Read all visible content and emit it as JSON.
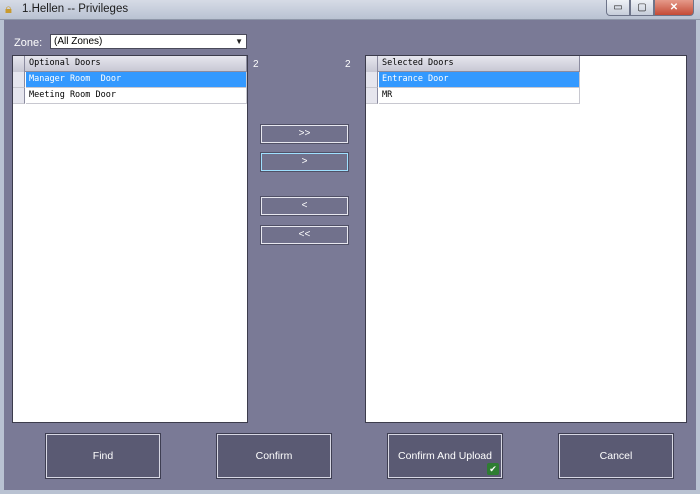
{
  "window": {
    "title": "1.Hellen -- Privileges",
    "minimize": "▭",
    "maximize": "▢",
    "close": "✕"
  },
  "zone": {
    "label": "Zone:",
    "selected": "(All Zones)"
  },
  "optional": {
    "count": "2",
    "header": "Optional Doors",
    "rows": [
      "Manager Room  Door",
      "Meeting Room Door"
    ]
  },
  "selected": {
    "count": "2",
    "header": "Selected Doors",
    "rows": [
      "Entrance Door",
      "MR"
    ]
  },
  "move_buttons": {
    "add_all": ">>",
    "add_one": ">",
    "remove_one": "<",
    "remove_all": "<<"
  },
  "actions": {
    "find": "Find",
    "confirm": "Confirm",
    "confirm_upload": "Confirm And Upload",
    "cancel": "Cancel"
  },
  "icons": {
    "app": "lock-icon",
    "upload_badge": "upload-check-icon"
  },
  "colors": {
    "background": "#7a7a96",
    "selection": "#3399ff",
    "button": "#5a5a73"
  }
}
